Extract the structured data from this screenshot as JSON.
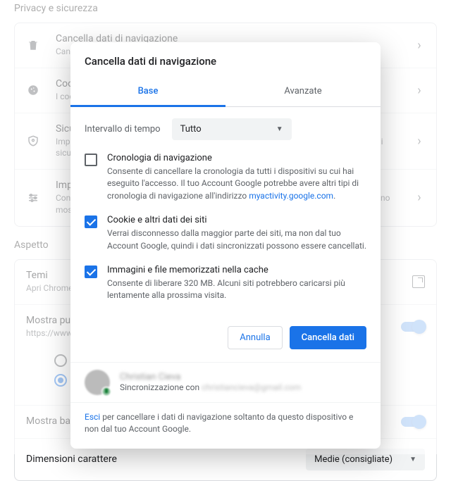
{
  "page": {
    "section_privacy": "Privacy e sicurezza",
    "section_appearance": "Aspetto"
  },
  "privacy_rows": [
    {
      "title": "Cancella dati di navigazione",
      "sub": "Cancella la cronologia, i cookie, la cache e altro"
    },
    {
      "title": "Cookie e altri dati dei siti",
      "sub": "I cookie di terze parti sono bloccati in modalità di navigazione in incognito"
    },
    {
      "title": "Sicurezza",
      "sub": "Impostazioni di Navigazione sicura (protezione da siti pericolosi) e altre impostazioni di sicurezza"
    },
    {
      "title": "Impostazioni sito",
      "sub": "Consente di controllare le informazioni che i siti possono usare e i contenuti che possono mostrare, ad esempio posizione, fotocamera, popup, video e altro"
    }
  ],
  "appearance": {
    "theme_title": "Temi",
    "theme_sub": "Apri Chrome Web Store",
    "home_title": "Mostra pulsante Home",
    "home_sub": "https://www.google.it/",
    "bookmarks": "Mostra barra dei Preferiti",
    "fontsize": "Dimensioni carattere",
    "fontsize_value": "Medie (consigliate)"
  },
  "dialog": {
    "title": "Cancella dati di navigazione",
    "tab_basic": "Base",
    "tab_advanced": "Avanzate",
    "interval_label": "Intervallo di tempo",
    "interval_value": "Tutto",
    "items": [
      {
        "checked": false,
        "title": "Cronologia di navigazione",
        "desc_pre": "Consente di cancellare la cronologia da tutti i dispositivi su cui hai eseguito l'accesso. Il tuo Account Google potrebbe avere altri tipi di cronologia di navigazione all'indirizzo ",
        "link": "myactivity.google.com",
        "desc_post": "."
      },
      {
        "checked": true,
        "title": "Cookie e altri dati dei siti",
        "desc": "Verrai disconnesso dalla maggior parte dei siti, ma non dal tuo Account Google, quindi i dati sincronizzati possono essere cancellati."
      },
      {
        "checked": true,
        "title": "Immagini e file memorizzati nella cache",
        "desc": "Consente di liberare 320 MB. Alcuni siti potrebbero caricarsi più lentamente alla prossima visita."
      }
    ],
    "cancel": "Annulla",
    "confirm": "Cancella dati",
    "account_name": "Christian Cieva",
    "account_sync_pre": "Sincronizzazione con ",
    "account_email": "christiancieva@gmail.com",
    "signout_link": "Esci",
    "signout_rest": " per cancellare i dati di navigazione soltanto da questo dispositivo e non dal tuo Account Google."
  }
}
